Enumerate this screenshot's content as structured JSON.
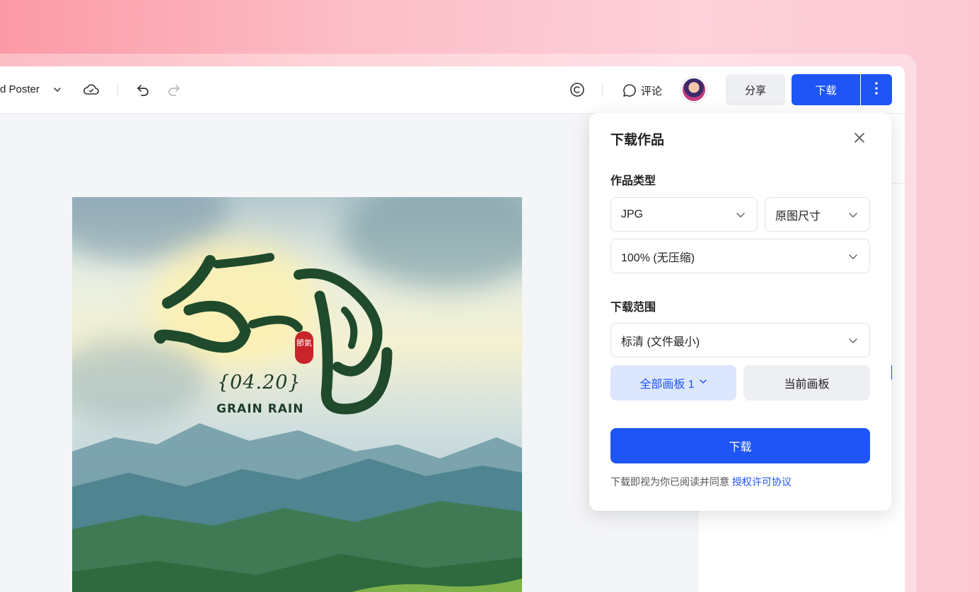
{
  "toolbar": {
    "doc_title": "d Poster",
    "comment_label": "评论",
    "share_label": "分享",
    "download_label": "下载",
    "icons": [
      "chevron-down-icon",
      "cloud-sync-icon",
      "undo-icon",
      "redo-icon",
      "copyright-icon",
      "comment-icon",
      "more-vertical-icon"
    ]
  },
  "poster": {
    "title_art": "谷雨",
    "seal_text": "節氣",
    "date": "{04.20}",
    "subtitle": "GRAIN RAIN"
  },
  "download_popover": {
    "title": "下载作品",
    "type_section_label": "作品类型",
    "format_value": "JPG",
    "size_value": "原图尺寸",
    "quality_value": "100% (无压缩)",
    "range_section_label": "下载范围",
    "resolution_value": "标清 (文件最小)",
    "all_boards_label": "全部画板 1",
    "current_board_label": "当前画板",
    "download_button": "下载",
    "agreement_text": "下载即视为你已阅读并同意",
    "agreement_link": "授权许可协议"
  },
  "colors": {
    "accent": "#1f55f6",
    "accent_light": "#dce6fd",
    "background_gradient_start": "#fb9aa6",
    "background_gradient_end": "#fcc9d3"
  }
}
